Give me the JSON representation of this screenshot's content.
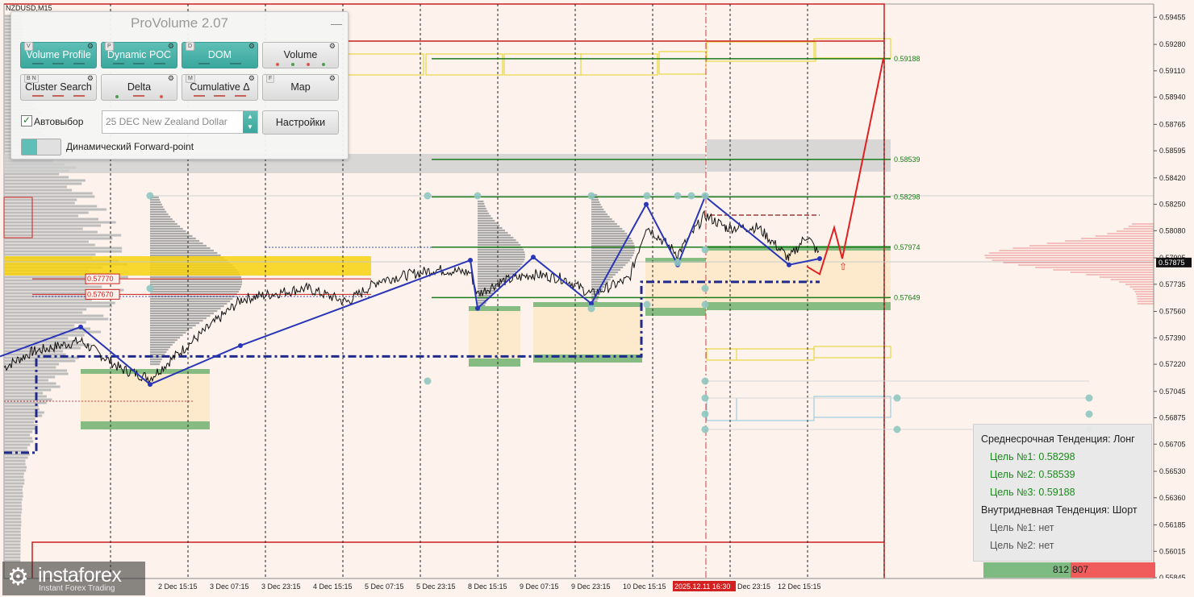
{
  "window": {
    "symbol_label": "NZDUSD,M15"
  },
  "panel": {
    "title": "ProVolume 2.07",
    "minimize_icon": "minimize-icon",
    "buttons": [
      {
        "key": "V",
        "label": "Volume Profile",
        "active": true
      },
      {
        "key": "P",
        "label": "Dynamic POC",
        "active": true
      },
      {
        "key": "D",
        "label": "DOM",
        "active": true
      },
      {
        "key": "",
        "label": "Volume",
        "active": false
      },
      {
        "key": "B N",
        "label": "Cluster Search",
        "active": false
      },
      {
        "key": "",
        "label": "Delta",
        "active": false
      },
      {
        "key": "M",
        "label": "Cumulative Δ",
        "active": false
      },
      {
        "key": "F",
        "label": "Map",
        "active": false
      }
    ],
    "autoselect_label": "Автовыбор",
    "autoselect_checked": true,
    "contract_value": "25 DEC New Zealand Dollar",
    "settings_label": "Настройки",
    "forward_point_label": "Динамический Forward-point"
  },
  "chart_data": {
    "type": "line",
    "title": "",
    "y_ticks": [
      "0.59455",
      "0.59280",
      "0.59110",
      "0.58940",
      "0.58765",
      "0.58595",
      "0.58420",
      "0.58250",
      "0.58080",
      "0.57905",
      "0.57735",
      "0.57560",
      "0.57390",
      "0.57220",
      "0.57045",
      "0.56875",
      "0.56705",
      "0.56530",
      "0.56360",
      "0.56185",
      "0.56015",
      "0.55845"
    ],
    "y_range": [
      0.5584,
      0.5954
    ],
    "current_price": "0.57875",
    "x_ticks": [
      "2 Dec 15:15",
      "3 Dec 07:15",
      "3 Dec 23:15",
      "4 Dec 15:15",
      "5 Dec 07:15",
      "5 Dec 23:15",
      "8 Dec 15:15",
      "9 Dec 07:15",
      "9 Dec 23:15",
      "10 Dec 15:15",
      "2025.12.11 16:30",
      "Dec 23:15",
      "12 Dec 15:15"
    ],
    "levels": [
      {
        "label": "0.59188",
        "value": 0.59188,
        "color": "#1a7a1a"
      },
      {
        "label": "0.58539",
        "value": 0.58539,
        "color": "#1a7a1a"
      },
      {
        "label": "0.58298",
        "value": 0.58298,
        "color": "#1a7a1a"
      },
      {
        "label": "0.57974",
        "value": 0.57974,
        "color": "#1a7a1a"
      },
      {
        "label": "0.57649",
        "value": 0.57649,
        "color": "#1a7a1a"
      }
    ],
    "left_labels": [
      {
        "label": "0.57770",
        "value": 0.5777
      },
      {
        "label": "0.57670",
        "value": 0.5767
      }
    ],
    "zigzag": [
      [
        0,
        0.5727
      ],
      [
        100,
        0.5746
      ],
      [
        186,
        0.5709
      ],
      [
        298,
        0.5734
      ],
      [
        583,
        0.5789
      ],
      [
        592,
        0.5758
      ],
      [
        661,
        0.5791
      ],
      [
        733,
        0.5761
      ],
      [
        801,
        0.5825
      ],
      [
        840,
        0.5786
      ],
      [
        874,
        0.583
      ],
      [
        978,
        0.5786
      ],
      [
        1016,
        0.579
      ]
    ],
    "forecast": [
      [
        1000,
        0.5785
      ],
      [
        1016,
        0.578
      ],
      [
        1034,
        0.581
      ],
      [
        1044,
        0.579
      ],
      [
        1095,
        0.5919
      ]
    ],
    "price_path": [
      [
        5,
        0.572
      ],
      [
        40,
        0.573
      ],
      [
        100,
        0.5737
      ],
      [
        150,
        0.5719
      ],
      [
        186,
        0.5713
      ],
      [
        230,
        0.5733
      ],
      [
        300,
        0.5764
      ],
      [
        380,
        0.5771
      ],
      [
        430,
        0.5762
      ],
      [
        470,
        0.5776
      ],
      [
        540,
        0.5783
      ],
      [
        583,
        0.5781
      ],
      [
        592,
        0.5767
      ],
      [
        620,
        0.5775
      ],
      [
        661,
        0.578
      ],
      [
        700,
        0.5777
      ],
      [
        733,
        0.5767
      ],
      [
        780,
        0.5777
      ],
      [
        801,
        0.5811
      ],
      [
        840,
        0.5793
      ],
      [
        874,
        0.5818
      ],
      [
        900,
        0.581
      ],
      [
        940,
        0.581
      ],
      [
        978,
        0.579
      ],
      [
        1000,
        0.5805
      ],
      [
        1016,
        0.5792
      ]
    ],
    "poc_line": [
      [
        5,
        0.5665
      ],
      [
        45,
        0.5665
      ],
      [
        45,
        0.5727
      ],
      [
        795,
        0.5727
      ],
      [
        795,
        0.5775
      ],
      [
        1016,
        0.5775
      ]
    ],
    "vertical_marker": "2025.12.11 16:30"
  },
  "info_box": {
    "mid_trend": "Среднесрочная Тенденция: Лонг",
    "mid_targets": [
      "Цель №1: 0.58298",
      "Цель №2: 0.58539",
      "Цель №3: 0.59188"
    ],
    "intraday_trend": "Внутридневная Тенденция: Шорт",
    "intraday_targets": [
      "Цель №1: нет",
      "Цель №2: нет"
    ],
    "buy_value": "812",
    "sell_value": "807",
    "target_color": "#1a8a1a"
  },
  "logo": {
    "name": "instaforex",
    "tagline": "Instant Forex Trading"
  }
}
